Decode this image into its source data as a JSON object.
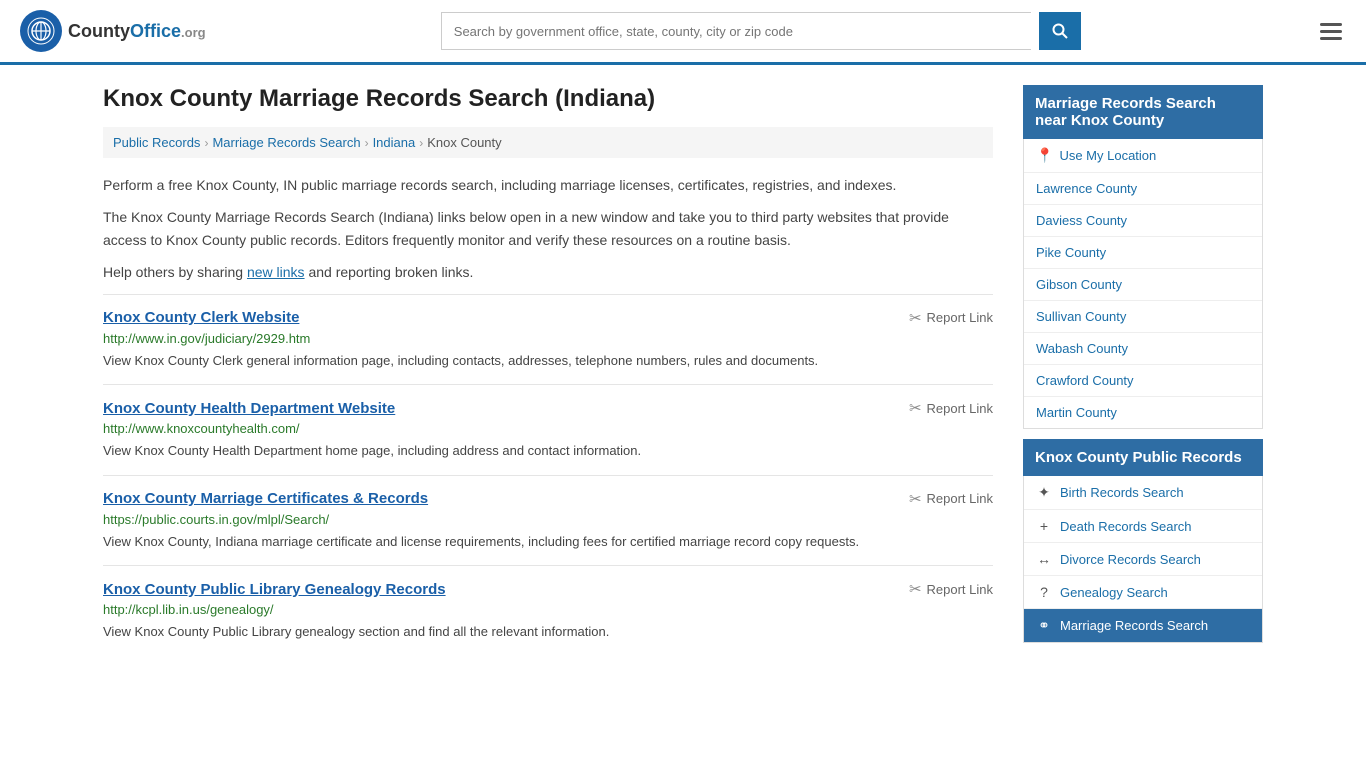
{
  "header": {
    "logo_text": "County",
    "logo_org": "Office",
    "logo_domain": ".org",
    "search_placeholder": "Search by government office, state, county, city or zip code"
  },
  "page": {
    "title": "Knox County Marriage Records Search (Indiana)"
  },
  "breadcrumb": {
    "items": [
      "Public Records",
      "Marriage Records Search",
      "Indiana",
      "Knox County"
    ]
  },
  "intro": {
    "paragraph1": "Perform a free Knox County, IN public marriage records search, including marriage licenses, certificates, registries, and indexes.",
    "paragraph2": "The Knox County Marriage Records Search (Indiana) links below open in a new window and take you to third party websites that provide access to Knox County public records. Editors frequently monitor and verify these resources on a routine basis.",
    "paragraph3_prefix": "Help others by sharing ",
    "paragraph3_link": "new links",
    "paragraph3_suffix": " and reporting broken links."
  },
  "records": [
    {
      "title": "Knox County Clerk Website",
      "url": "http://www.in.gov/judiciary/2929.htm",
      "description": "View Knox County Clerk general information page, including contacts, addresses, telephone numbers, rules and documents.",
      "report_label": "Report Link"
    },
    {
      "title": "Knox County Health Department Website",
      "url": "http://www.knoxcountyhealth.com/",
      "description": "View Knox County Health Department home page, including address and contact information.",
      "report_label": "Report Link"
    },
    {
      "title": "Knox County Marriage Certificates & Records",
      "url": "https://public.courts.in.gov/mlpl/Search/",
      "description": "View Knox County, Indiana marriage certificate and license requirements, including fees for certified marriage record copy requests.",
      "report_label": "Report Link"
    },
    {
      "title": "Knox County Public Library Genealogy Records",
      "url": "http://kcpl.lib.in.us/genealogy/",
      "description": "View Knox County Public Library genealogy section and find all the relevant information.",
      "report_label": "Report Link"
    }
  ],
  "sidebar": {
    "nearby_title": "Marriage Records Search near Knox County",
    "use_location": "Use My Location",
    "nearby_counties": [
      "Lawrence County",
      "Daviess County",
      "Pike County",
      "Gibson County",
      "Sullivan County",
      "Wabash County",
      "Crawford County",
      "Martin County"
    ],
    "public_records_title": "Knox County Public Records",
    "public_records_items": [
      {
        "icon": "✦",
        "label": "Birth Records Search"
      },
      {
        "icon": "+",
        "label": "Death Records Search"
      },
      {
        "icon": "↔",
        "label": "Divorce Records Search"
      },
      {
        "icon": "?",
        "label": "Genealogy Search"
      },
      {
        "icon": "⚭",
        "label": "Marriage Records Search"
      }
    ]
  }
}
